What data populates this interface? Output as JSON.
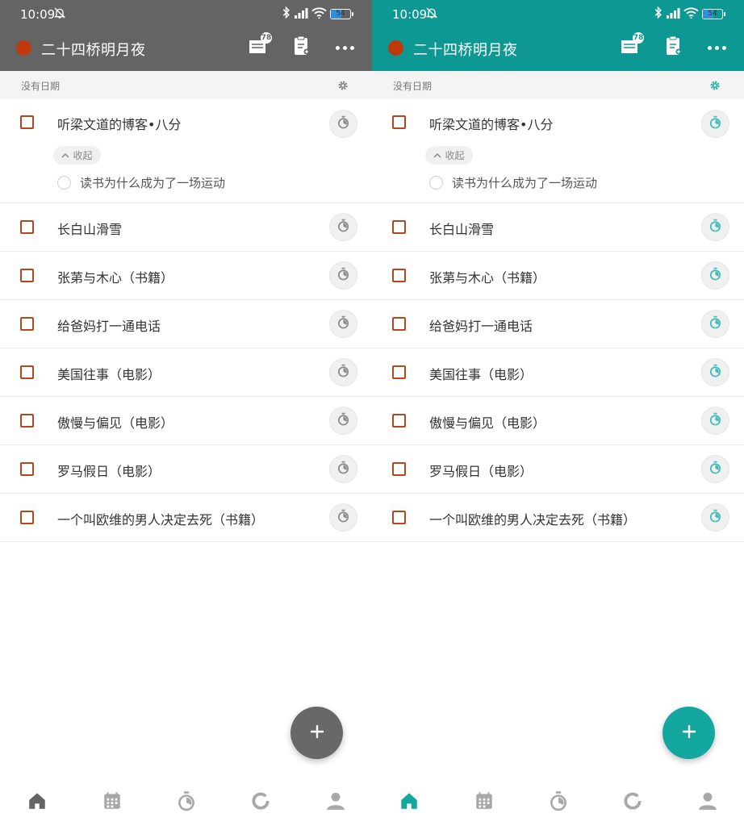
{
  "screens": [
    {
      "theme": "gray",
      "accent": "#646464",
      "status": {
        "time": "10:09",
        "battery": "54"
      },
      "header": {
        "project_title": "二十四桥明月夜",
        "inbox_badge": "78"
      },
      "section": {
        "label": "没有日期"
      },
      "tasks": [
        {
          "label": "听梁文道的博客•八分",
          "collapse_label": "收起",
          "subtask": "读书为什么成为了一场运动"
        },
        {
          "label": "长白山滑雪"
        },
        {
          "label": "张苐与木心（书籍）"
        },
        {
          "label": "给爸妈打一通电话"
        },
        {
          "label": "美国往事（电影）"
        },
        {
          "label": "傲慢与偏见（电影）"
        },
        {
          "label": "罗马假日（电影）"
        },
        {
          "label": "一个叫欧维的男人决定去死（书籍）"
        }
      ],
      "nav": [
        "home-icon",
        "calendar-icon",
        "timer-icon",
        "stats-icon",
        "profile-icon"
      ]
    },
    {
      "theme": "teal",
      "accent": "#0d9894",
      "status": {
        "time": "10:09",
        "battery": "54"
      },
      "header": {
        "project_title": "二十四桥明月夜",
        "inbox_badge": "78"
      },
      "section": {
        "label": "没有日期"
      },
      "tasks": [
        {
          "label": "听梁文道的博客•八分",
          "collapse_label": "收起",
          "subtask": "读书为什么成为了一场运动"
        },
        {
          "label": "长白山滑雪"
        },
        {
          "label": "张苐与木心（书籍）"
        },
        {
          "label": "给爸妈打一通电话"
        },
        {
          "label": "美国往事（电影）"
        },
        {
          "label": "傲慢与偏见（电影）"
        },
        {
          "label": "罗马假日（电影）"
        },
        {
          "label": "一个叫欧维的男人决定去死（书籍）"
        }
      ],
      "nav": [
        "home-icon",
        "calendar-icon",
        "timer-icon",
        "stats-icon",
        "profile-icon"
      ]
    }
  ]
}
